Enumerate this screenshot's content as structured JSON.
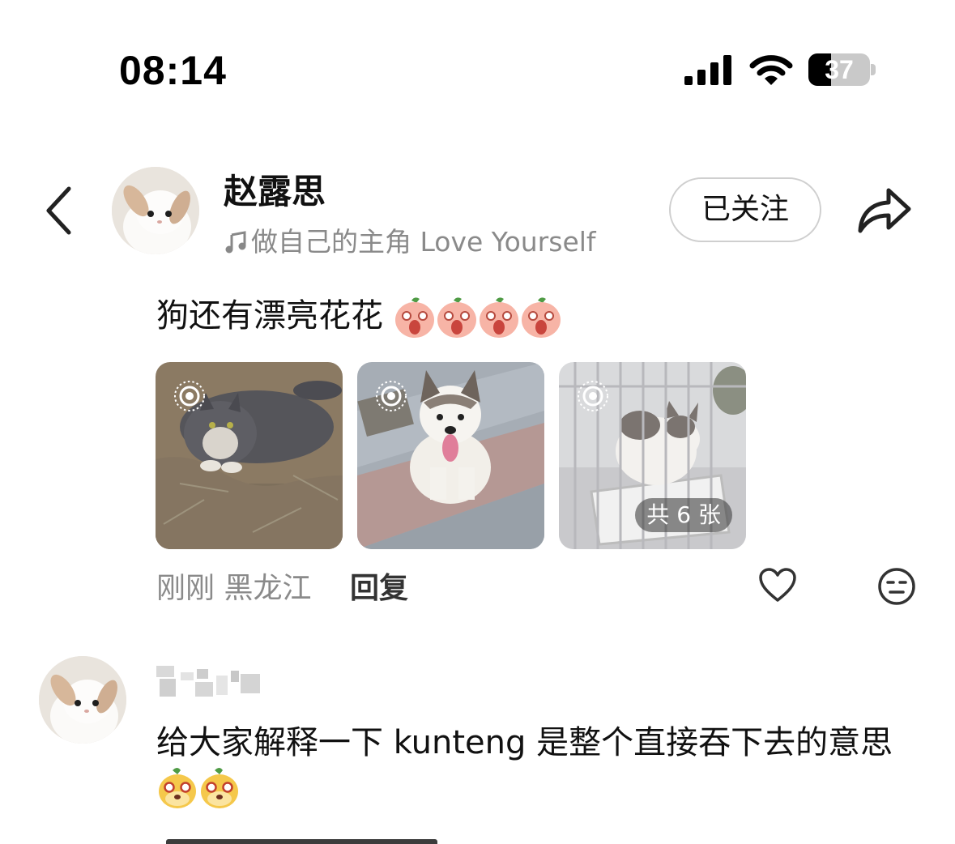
{
  "status_bar": {
    "time": "08:14",
    "battery_level": "37",
    "battery_fraction": 0.37
  },
  "header": {
    "author_name": "赵露思",
    "music_title": "做自己的主角 Love Yourself",
    "follow_label": "已关注"
  },
  "post": {
    "text": "狗还有漂亮花花",
    "photo_count_label": "共 6 张",
    "time": "刚刚",
    "location": "黑龙江",
    "reply_label": "回复"
  },
  "comment": {
    "text": "给大家解释一下 kunteng 是整个直接吞下去的意思"
  },
  "colors": {
    "text": "#111111",
    "secondary": "#8a8a8a",
    "button_border": "#cfcfcf"
  }
}
